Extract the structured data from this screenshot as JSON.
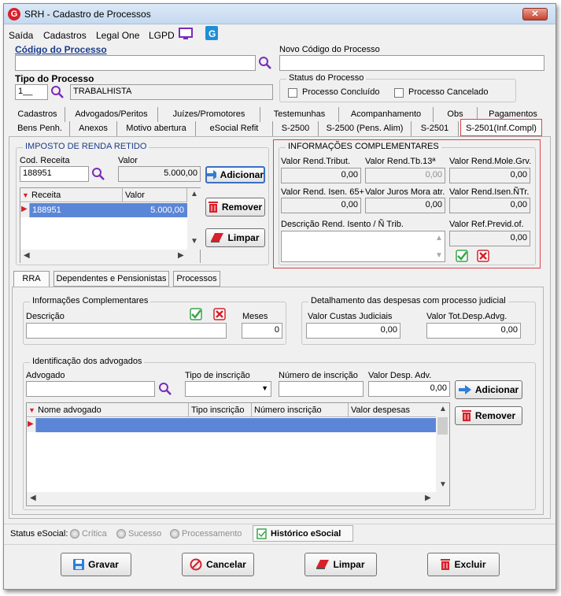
{
  "window": {
    "title": "SRH - Cadastro de Processos",
    "close": "✕"
  },
  "menu": [
    "Saída",
    "Cadastros",
    "Legal One",
    "LGPD"
  ],
  "header": {
    "codigo_label": "Código do Processo",
    "codigo_value": "",
    "novo_codigo_label": "Novo Código do Processo",
    "novo_codigo_value": "",
    "tipo_label": "Tipo do Processo",
    "tipo_code": "1__",
    "tipo_desc": "TRABALHISTA",
    "status_legend": "Status do Processo",
    "status_concluido": "Processo Concluído",
    "status_cancelado": "Processo Cancelado"
  },
  "tabs_row1": [
    "Cadastros",
    "Advogados/Peritos",
    "Juízes/Promotores",
    "Testemunhas",
    "Acompanhamento",
    "Obs",
    "Pagamentos"
  ],
  "tabs_row2": [
    "Bens Penh.",
    "Anexos",
    "Motivo abertura",
    "eSocial Refit",
    "S-2500",
    "S-2500 (Pens. Alim)",
    "S-2501",
    "S-2501(Inf.Compl)"
  ],
  "irrf": {
    "legend": "IMPOSTO DE RENDA RETIDO",
    "cod_label": "Cod. Receita",
    "valor_label": "Valor",
    "cod_value": "188951",
    "valor_value": "5.000,00",
    "grid_headers": [
      "Receita",
      "Valor"
    ],
    "rows": [
      {
        "receita": "188951",
        "valor": "5.000,00"
      }
    ],
    "btn_adicionar": "Adicionar",
    "btn_remover": "Remover",
    "btn_limpar": "Limpar"
  },
  "info_compl": {
    "legend": "INFORMAÇÕES COMPLEMENTARES",
    "fields": [
      {
        "label": "Valor Rend.Tribut.",
        "value": "0,00"
      },
      {
        "label": "Valor Rend.Tb.13ª",
        "value": "0,00"
      },
      {
        "label": "Valor Rend.Mole.Grv.",
        "value": "0,00"
      },
      {
        "label": "Valor Rend. Isen. 65+",
        "value": "0,00"
      },
      {
        "label": "Valor Juros Mora atr.",
        "value": "0,00"
      },
      {
        "label": "Valor Rend.Isen.ÑTr.",
        "value": "0,00"
      }
    ],
    "desc_label": "Descrição Rend. Isento / Ñ Trib.",
    "desc_value": "",
    "ref_label": "Valor Ref.Previd.of.",
    "ref_value": "0,00"
  },
  "subtabs": [
    "RRA",
    "Dependentes e Pensionistas",
    "Processos"
  ],
  "rra": {
    "info_legend": "Informações Complementares",
    "descricao_label": "Descrição",
    "descricao_value": "",
    "meses_label": "Meses",
    "meses_value": "0",
    "despesas_legend": "Detalhamento das despesas com processo judicial",
    "custas_label": "Valor Custas Judiciais",
    "custas_value": "0,00",
    "advg_label": "Valor Tot.Desp.Advg.",
    "advg_value": "0,00",
    "adv_legend": "Identificação dos advogados",
    "advogado_label": "Advogado",
    "advogado_value": "",
    "tipo_insc_label": "Tipo de inscrição",
    "tipo_insc_value": "",
    "num_insc_label": "Número de inscrição",
    "num_insc_value": "",
    "desp_label": "Valor Desp. Adv.",
    "desp_value": "0,00",
    "grid_headers": [
      "Nome advogado",
      "Tipo inscrição",
      "Número inscrição",
      "Valor despesas"
    ],
    "btn_adicionar": "Adicionar",
    "btn_remover": "Remover"
  },
  "status_bar": {
    "label": "Status eSocial:",
    "critica": "Crítica",
    "sucesso": "Sucesso",
    "processamento": "Processamento",
    "historico": "Histórico eSocial"
  },
  "footer": {
    "gravar": "Gravar",
    "cancelar": "Cancelar",
    "limpar": "Limpar",
    "excluir": "Excluir"
  },
  "colors": {
    "accent_red": "#d8202a",
    "selection_blue": "#5b86d7",
    "highlight_red": "#d9454a",
    "title_blue": "#1a3c8a"
  }
}
